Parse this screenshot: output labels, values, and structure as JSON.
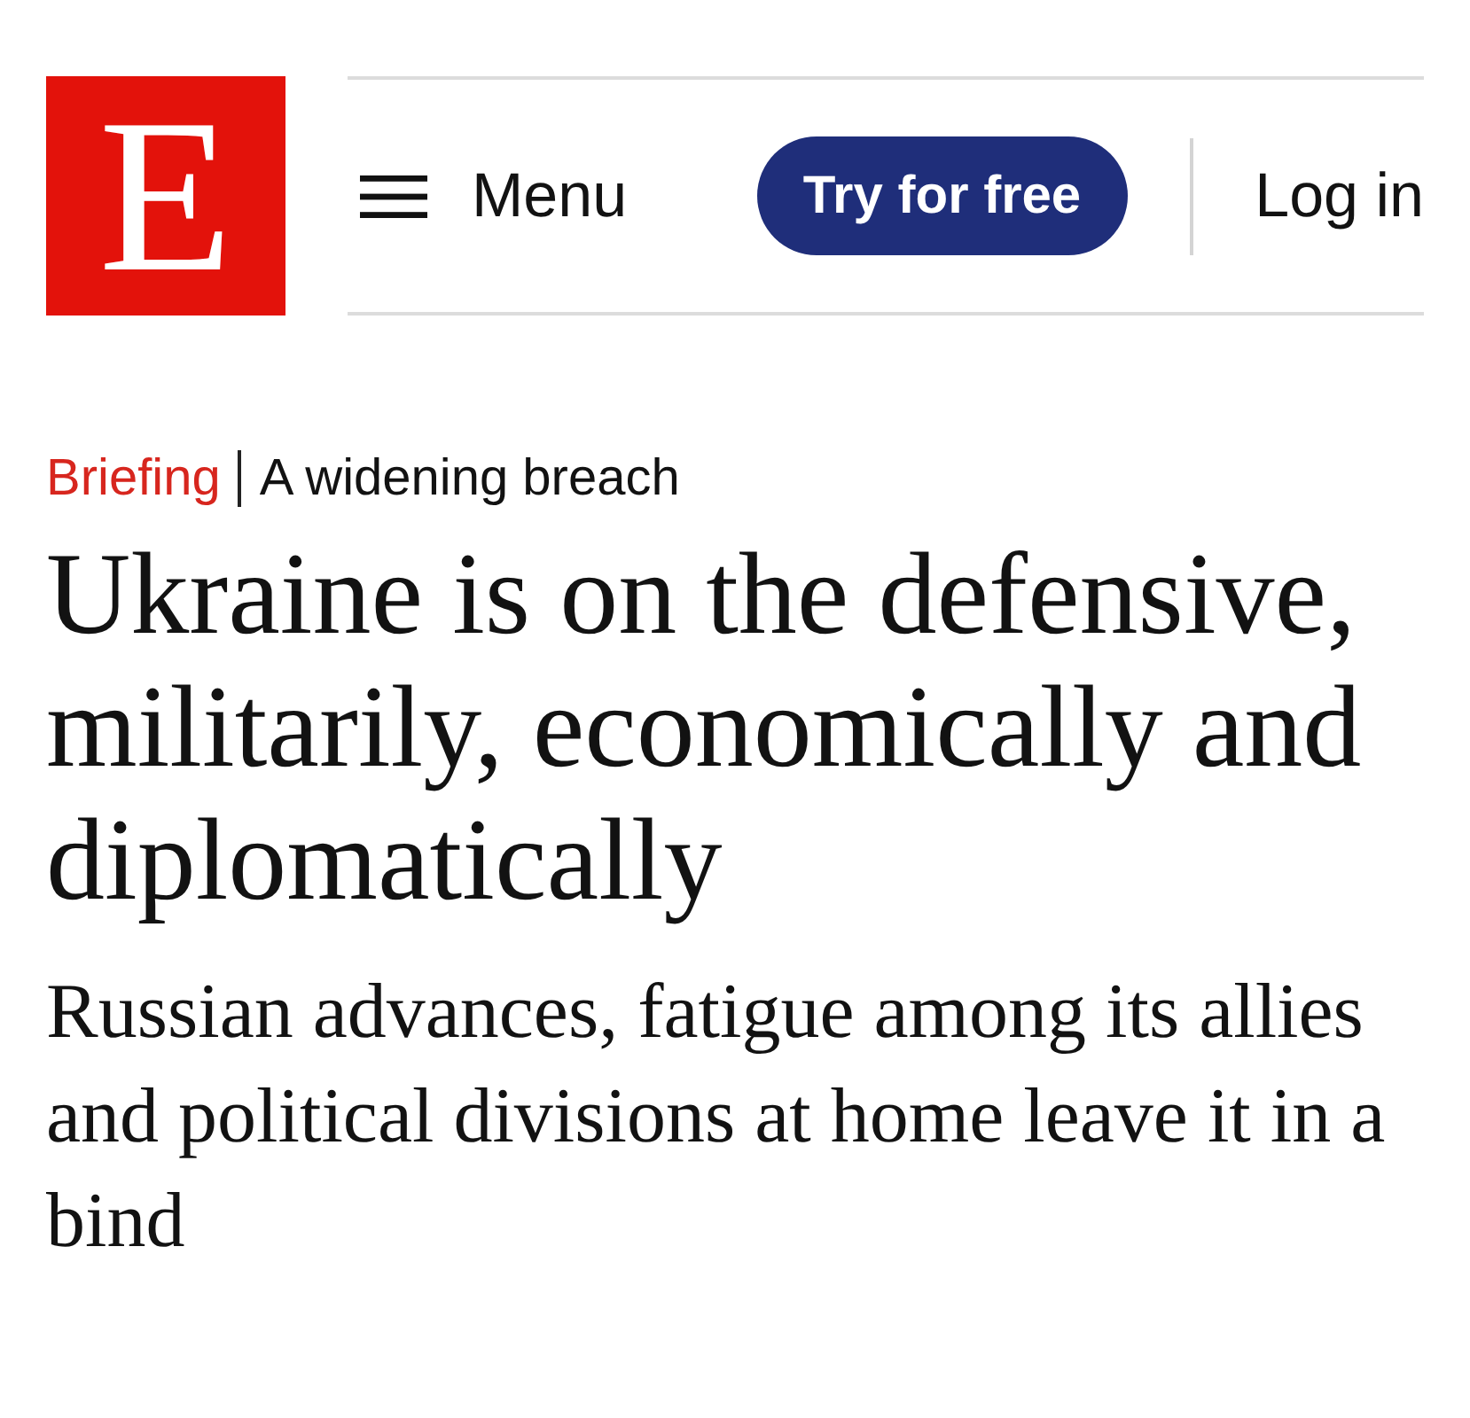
{
  "logo": {
    "letter": "E"
  },
  "header": {
    "menu": {
      "label": "Menu"
    },
    "cta": {
      "label": "Try for free"
    },
    "login": {
      "label": "Log in"
    }
  },
  "article": {
    "kicker": {
      "section": "Briefing",
      "topic": "A widening breach"
    },
    "headline": "Ukraine is on the defensive, militarily, economically and diplomatically",
    "standfirst": "Russian advances, fatigue among its allies and political divisions at home leave it in a bind"
  }
}
